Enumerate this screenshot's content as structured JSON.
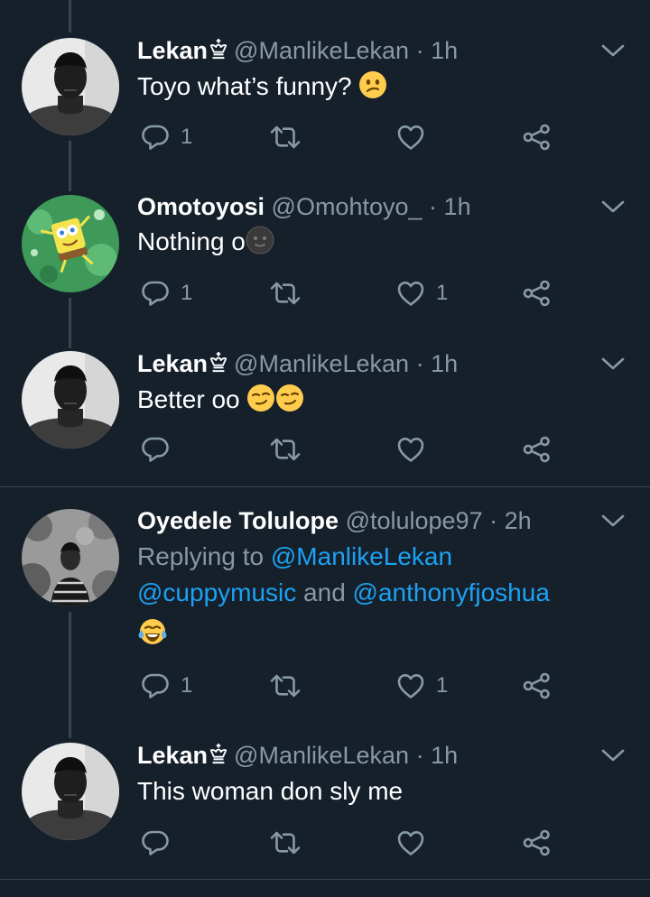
{
  "tweets": [
    {
      "name": "Lekan",
      "handle": "@ManlikeLekan",
      "time": "1h",
      "text": "Toyo what’s funny?",
      "emoji": "confused-face",
      "reply_count": "1",
      "like_count": ""
    },
    {
      "name": "Omotoyosi",
      "handle": "@Omohtoyo_",
      "time": "1h",
      "text": "Nothing o",
      "emoji": "new-moon-face",
      "reply_count": "1",
      "like_count": "1"
    },
    {
      "name": "Lekan",
      "handle": "@ManlikeLekan",
      "time": "1h",
      "text": "Better oo",
      "emoji": "smirking-face x2",
      "reply_count": "",
      "like_count": ""
    },
    {
      "name": "Oyedele Tolulope",
      "handle": "@tolulope97",
      "time": "2h",
      "replying_prefix": "Replying to",
      "mention_1": "@ManlikeLekan",
      "mention_2": "@cuppymusic",
      "and_word": "and",
      "mention_3": "@anthonyfjoshua",
      "emoji": "tears-of-joy-face",
      "reply_count": "1",
      "like_count": "1"
    },
    {
      "name": "Lekan",
      "handle": "@ManlikeLekan",
      "time": "1h",
      "text": "This woman don sly me",
      "reply_count": "",
      "like_count": ""
    }
  ],
  "separator": "·",
  "colors": {
    "background": "#15202b",
    "secondary_text": "#8899a6",
    "link": "#1da1f2",
    "divider": "#38444d"
  },
  "icons": [
    "reply-icon",
    "retweet-icon",
    "like-icon",
    "share-icon",
    "chevron-down-icon",
    "crown-icon"
  ]
}
